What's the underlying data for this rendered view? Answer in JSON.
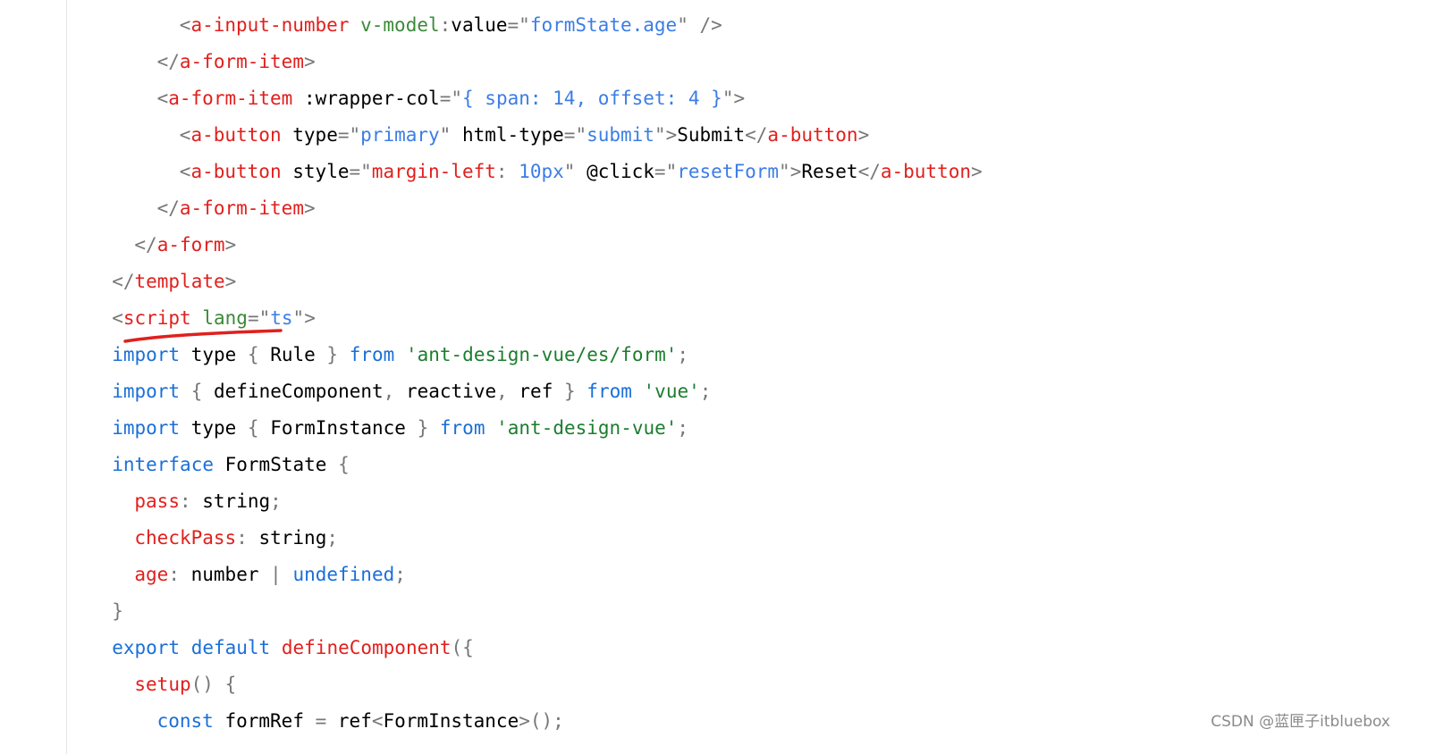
{
  "code_lines": [
    {
      "indent": "        ",
      "tokens": [
        {
          "t": "<",
          "c": "punct"
        },
        {
          "t": "a-input-number",
          "c": "tag"
        },
        {
          "t": " ",
          "c": "plain"
        },
        {
          "t": "v-model",
          "c": "attr"
        },
        {
          "t": ":",
          "c": "punct"
        },
        {
          "t": "value",
          "c": "plain"
        },
        {
          "t": "=",
          "c": "punct"
        },
        {
          "t": "\"",
          "c": "punct"
        },
        {
          "t": "formState.age",
          "c": "string"
        },
        {
          "t": "\"",
          "c": "punct"
        },
        {
          "t": " />",
          "c": "punct"
        }
      ]
    },
    {
      "indent": "      ",
      "tokens": [
        {
          "t": "</",
          "c": "punct"
        },
        {
          "t": "a-form-item",
          "c": "tag"
        },
        {
          "t": ">",
          "c": "punct"
        }
      ]
    },
    {
      "indent": "      ",
      "tokens": [
        {
          "t": "<",
          "c": "punct"
        },
        {
          "t": "a-form-item",
          "c": "tag"
        },
        {
          "t": " ",
          "c": "plain"
        },
        {
          "t": ":wrapper-col",
          "c": "plain"
        },
        {
          "t": "=",
          "c": "punct"
        },
        {
          "t": "\"",
          "c": "punct"
        },
        {
          "t": "{ span: 14, offset: 4 }",
          "c": "string"
        },
        {
          "t": "\"",
          "c": "punct"
        },
        {
          "t": ">",
          "c": "punct"
        }
      ]
    },
    {
      "indent": "        ",
      "tokens": [
        {
          "t": "<",
          "c": "punct"
        },
        {
          "t": "a-button",
          "c": "tag"
        },
        {
          "t": " ",
          "c": "plain"
        },
        {
          "t": "type",
          "c": "plain"
        },
        {
          "t": "=",
          "c": "punct"
        },
        {
          "t": "\"",
          "c": "punct"
        },
        {
          "t": "primary",
          "c": "string"
        },
        {
          "t": "\"",
          "c": "punct"
        },
        {
          "t": " ",
          "c": "plain"
        },
        {
          "t": "html-type",
          "c": "plain"
        },
        {
          "t": "=",
          "c": "punct"
        },
        {
          "t": "\"",
          "c": "punct"
        },
        {
          "t": "submit",
          "c": "string"
        },
        {
          "t": "\"",
          "c": "punct"
        },
        {
          "t": ">",
          "c": "punct"
        },
        {
          "t": "Submit",
          "c": "plain"
        },
        {
          "t": "</",
          "c": "punct"
        },
        {
          "t": "a-button",
          "c": "tag"
        },
        {
          "t": ">",
          "c": "punct"
        }
      ]
    },
    {
      "indent": "        ",
      "tokens": [
        {
          "t": "<",
          "c": "punct"
        },
        {
          "t": "a-button",
          "c": "tag"
        },
        {
          "t": " ",
          "c": "plain"
        },
        {
          "t": "style",
          "c": "plain"
        },
        {
          "t": "=",
          "c": "punct"
        },
        {
          "t": "\"",
          "c": "punct"
        },
        {
          "t": "margin-left",
          "c": "str2"
        },
        {
          "t": ":",
          "c": "punct"
        },
        {
          "t": " 10px",
          "c": "string"
        },
        {
          "t": "\"",
          "c": "punct"
        },
        {
          "t": " ",
          "c": "plain"
        },
        {
          "t": "@click",
          "c": "plain"
        },
        {
          "t": "=",
          "c": "punct"
        },
        {
          "t": "\"",
          "c": "punct"
        },
        {
          "t": "resetForm",
          "c": "string"
        },
        {
          "t": "\"",
          "c": "punct"
        },
        {
          "t": ">",
          "c": "punct"
        },
        {
          "t": "Reset",
          "c": "plain"
        },
        {
          "t": "</",
          "c": "punct"
        },
        {
          "t": "a-button",
          "c": "tag"
        },
        {
          "t": ">",
          "c": "punct"
        }
      ]
    },
    {
      "indent": "      ",
      "tokens": [
        {
          "t": "</",
          "c": "punct"
        },
        {
          "t": "a-form-item",
          "c": "tag"
        },
        {
          "t": ">",
          "c": "punct"
        }
      ]
    },
    {
      "indent": "    ",
      "tokens": [
        {
          "t": "</",
          "c": "punct"
        },
        {
          "t": "a-form",
          "c": "tag"
        },
        {
          "t": ">",
          "c": "punct"
        }
      ]
    },
    {
      "indent": "  ",
      "tokens": [
        {
          "t": "</",
          "c": "punct"
        },
        {
          "t": "template",
          "c": "tag"
        },
        {
          "t": ">",
          "c": "punct"
        }
      ]
    },
    {
      "indent": "  ",
      "tokens": [
        {
          "t": "<",
          "c": "punct"
        },
        {
          "t": "script",
          "c": "tag"
        },
        {
          "t": " ",
          "c": "plain"
        },
        {
          "t": "lang",
          "c": "attr"
        },
        {
          "t": "=",
          "c": "punct"
        },
        {
          "t": "\"",
          "c": "punct"
        },
        {
          "t": "ts",
          "c": "string"
        },
        {
          "t": "\"",
          "c": "punct"
        },
        {
          "t": ">",
          "c": "punct"
        }
      ]
    },
    {
      "indent": "  ",
      "tokens": [
        {
          "t": "import",
          "c": "keyword"
        },
        {
          "t": " type ",
          "c": "plain"
        },
        {
          "t": "{",
          "c": "punct"
        },
        {
          "t": " Rule ",
          "c": "plain"
        },
        {
          "t": "}",
          "c": "punct"
        },
        {
          "t": " ",
          "c": "plain"
        },
        {
          "t": "from",
          "c": "keyword"
        },
        {
          "t": " ",
          "c": "plain"
        },
        {
          "t": "'ant-design-vue/es/form'",
          "c": "squote"
        },
        {
          "t": ";",
          "c": "punct"
        }
      ]
    },
    {
      "indent": "  ",
      "tokens": [
        {
          "t": "import",
          "c": "keyword"
        },
        {
          "t": " ",
          "c": "plain"
        },
        {
          "t": "{",
          "c": "punct"
        },
        {
          "t": " defineComponent",
          "c": "plain"
        },
        {
          "t": ",",
          "c": "punct"
        },
        {
          "t": " reactive",
          "c": "plain"
        },
        {
          "t": ",",
          "c": "punct"
        },
        {
          "t": " ref ",
          "c": "plain"
        },
        {
          "t": "}",
          "c": "punct"
        },
        {
          "t": " ",
          "c": "plain"
        },
        {
          "t": "from",
          "c": "keyword"
        },
        {
          "t": " ",
          "c": "plain"
        },
        {
          "t": "'vue'",
          "c": "squote"
        },
        {
          "t": ";",
          "c": "punct"
        }
      ]
    },
    {
      "indent": "  ",
      "tokens": [
        {
          "t": "import",
          "c": "keyword"
        },
        {
          "t": " type ",
          "c": "plain"
        },
        {
          "t": "{",
          "c": "punct"
        },
        {
          "t": " FormInstance ",
          "c": "plain"
        },
        {
          "t": "}",
          "c": "punct"
        },
        {
          "t": " ",
          "c": "plain"
        },
        {
          "t": "from",
          "c": "keyword"
        },
        {
          "t": " ",
          "c": "plain"
        },
        {
          "t": "'ant-design-vue'",
          "c": "squote"
        },
        {
          "t": ";",
          "c": "punct"
        }
      ]
    },
    {
      "indent": "  ",
      "tokens": [
        {
          "t": "interface",
          "c": "keyword"
        },
        {
          "t": " FormState ",
          "c": "plain"
        },
        {
          "t": "{",
          "c": "punct"
        }
      ]
    },
    {
      "indent": "    ",
      "tokens": [
        {
          "t": "pass",
          "c": "prop"
        },
        {
          "t": ":",
          "c": "punct"
        },
        {
          "t": " string",
          "c": "plain"
        },
        {
          "t": ";",
          "c": "punct"
        }
      ]
    },
    {
      "indent": "    ",
      "tokens": [
        {
          "t": "checkPass",
          "c": "prop"
        },
        {
          "t": ":",
          "c": "punct"
        },
        {
          "t": " string",
          "c": "plain"
        },
        {
          "t": ";",
          "c": "punct"
        }
      ]
    },
    {
      "indent": "    ",
      "tokens": [
        {
          "t": "age",
          "c": "prop"
        },
        {
          "t": ":",
          "c": "punct"
        },
        {
          "t": " number ",
          "c": "plain"
        },
        {
          "t": "|",
          "c": "punct"
        },
        {
          "t": " ",
          "c": "plain"
        },
        {
          "t": "undefined",
          "c": "keyword"
        },
        {
          "t": ";",
          "c": "punct"
        }
      ]
    },
    {
      "indent": "  ",
      "tokens": [
        {
          "t": "}",
          "c": "punct"
        }
      ]
    },
    {
      "indent": "  ",
      "tokens": [
        {
          "t": "export",
          "c": "keyword"
        },
        {
          "t": " ",
          "c": "plain"
        },
        {
          "t": "default",
          "c": "keyword"
        },
        {
          "t": " ",
          "c": "plain"
        },
        {
          "t": "defineComponent",
          "c": "prop"
        },
        {
          "t": "({",
          "c": "punct"
        }
      ]
    },
    {
      "indent": "    ",
      "tokens": [
        {
          "t": "setup",
          "c": "prop"
        },
        {
          "t": "()",
          "c": "punct"
        },
        {
          "t": " ",
          "c": "plain"
        },
        {
          "t": "{",
          "c": "punct"
        }
      ]
    },
    {
      "indent": "      ",
      "tokens": [
        {
          "t": "const",
          "c": "keyword"
        },
        {
          "t": " formRef ",
          "c": "plain"
        },
        {
          "t": "=",
          "c": "punct"
        },
        {
          "t": " ref",
          "c": "plain"
        },
        {
          "t": "<",
          "c": "punct"
        },
        {
          "t": "FormInstance",
          "c": "plain"
        },
        {
          "t": ">",
          "c": "punct"
        },
        {
          "t": "();",
          "c": "punct"
        }
      ]
    }
  ],
  "watermark": "CSDN @蓝匣子itbluebox",
  "colors": {
    "punct": "#777777",
    "tag": "#e0201d",
    "attr": "#3a8a37",
    "plain": "#000000",
    "string": "#3b7de6",
    "str2": "#e0201d",
    "keyword": "#1a6fd8",
    "squote": "#1c7d2e",
    "prop": "#e0201d",
    "annotation": "#e0201d"
  }
}
